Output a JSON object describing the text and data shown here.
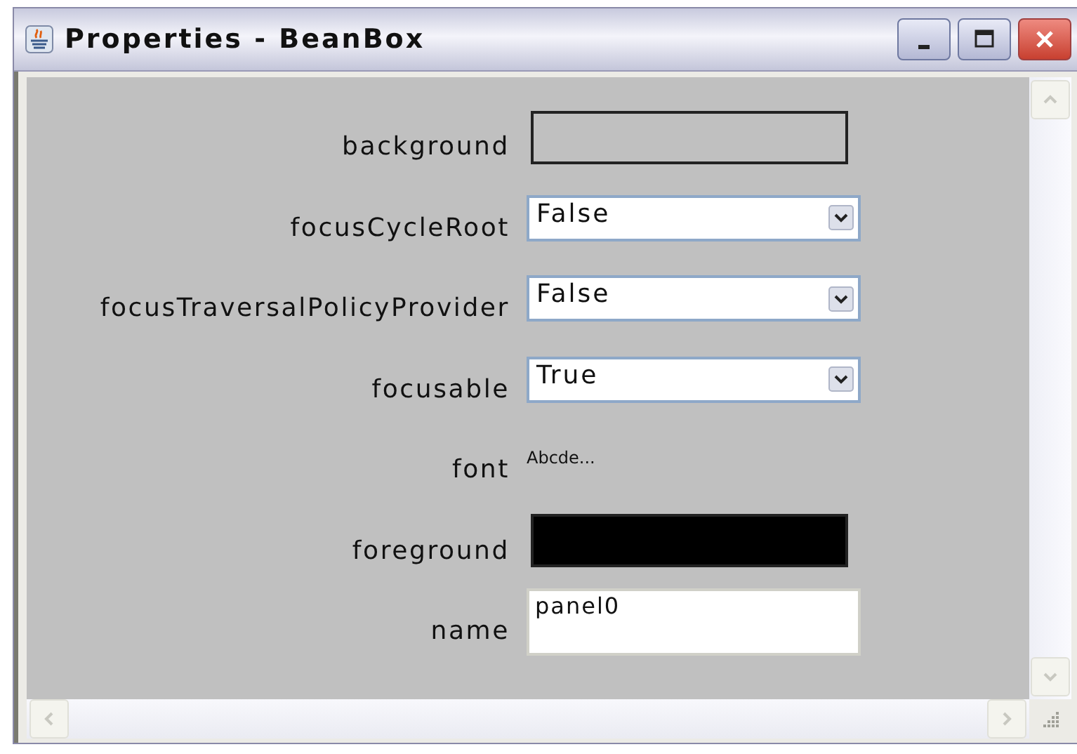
{
  "window": {
    "title": "Properties - BeanBox"
  },
  "properties": [
    {
      "label": "background",
      "kind": "color",
      "color": "#c0c0c0"
    },
    {
      "label": "focusCycleRoot",
      "kind": "choice",
      "value": "False"
    },
    {
      "label": "focusTraversalPolicyProvider",
      "kind": "choice",
      "value": "False"
    },
    {
      "label": "focusable",
      "kind": "choice",
      "value": "True"
    },
    {
      "label": "font",
      "kind": "preview",
      "value": "Abcde..."
    },
    {
      "label": "foreground",
      "kind": "color",
      "color": "#000000"
    },
    {
      "label": "name",
      "kind": "text",
      "value": "panel0"
    }
  ]
}
